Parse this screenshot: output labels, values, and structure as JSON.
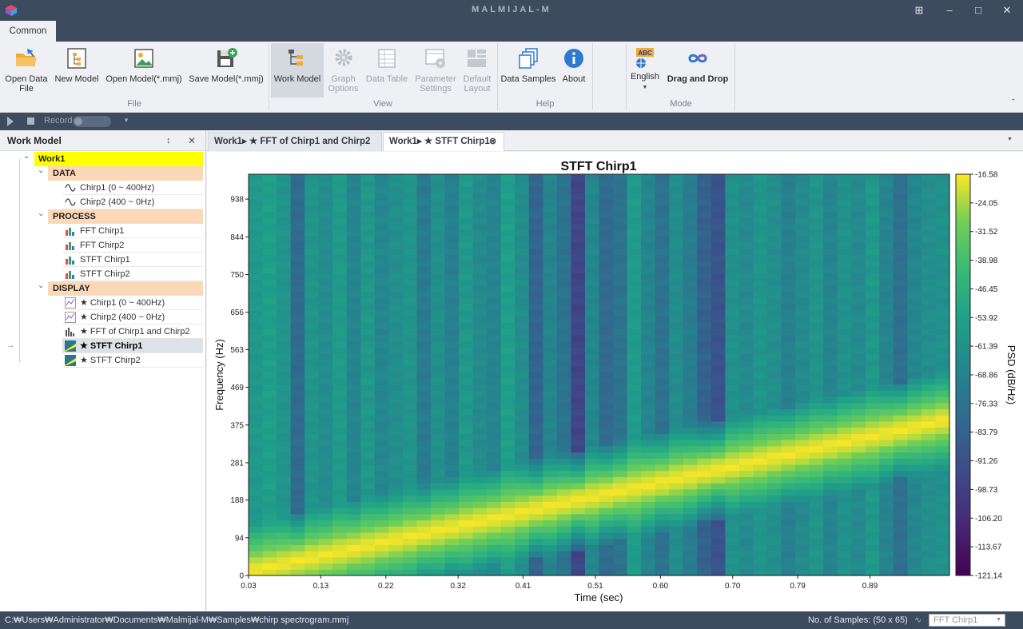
{
  "app": {
    "title": "MALMIJAL-M"
  },
  "tabs": {
    "common": "Common"
  },
  "ribbon": {
    "file": {
      "label": "File",
      "open_data_file": "Open Data File",
      "new_model": "New Model",
      "open_model": "Open Model(*.mmj)",
      "save_model": "Save Model(*.mmj)"
    },
    "view": {
      "label": "View",
      "work_model": "Work Model",
      "graph_options": "Graph Options",
      "data_table": "Data Table",
      "parameter_settings": "Parameter Settings",
      "default_layout": "Default Layout"
    },
    "help": {
      "label": "Help",
      "data_samples": "Data Samples",
      "about": "About"
    },
    "mode": {
      "label": "Mode",
      "english": "English",
      "abc": "ABC",
      "drag_and_drop": "Drag and Drop"
    }
  },
  "recordbar": {
    "record": "Record"
  },
  "work_model": {
    "title": "Work Model",
    "root": "Work1",
    "categories": [
      {
        "label": "DATA",
        "items": [
          "Chirp1 (0 ~ 400Hz)",
          "Chirp2 (400 ~ 0Hz)"
        ]
      },
      {
        "label": "PROCESS",
        "items": [
          "FFT Chirp1",
          "FFT Chirp2",
          "STFT Chirp1",
          "STFT Chirp2"
        ]
      },
      {
        "label": "DISPLAY",
        "items": [
          "★ Chirp1 (0 ~ 400Hz)",
          "★ Chirp2 (400 ~ 0Hz)",
          "★ FFT of Chirp1 and Chirp2",
          "★ STFT Chirp1",
          "★ STFT Chirp2"
        ]
      }
    ],
    "selected": "★ STFT Chirp1"
  },
  "doc_tabs": [
    {
      "label": "Work1▸ ★ FFT of Chirp1 and Chirp2",
      "active": false
    },
    {
      "label": "Work1▸ ★ STFT Chirp1",
      "active": true
    }
  ],
  "status": {
    "path": "C:₩Users₩Administrator₩Documents₩Malmijal-M₩Samples₩chirp spectrogram.mmj",
    "samples": "No. of Samples: (50 x 65)",
    "selector": "FFT Chirp1"
  },
  "colors": {
    "titlebar": "#3d4b5e",
    "category_bg": "#fbd9b8",
    "root_bg": "#ffff00"
  },
  "chart_data": {
    "type": "heatmap",
    "title": "STFT Chirp1",
    "xlabel": "Time (sec)",
    "ylabel": "Frequency (Hz)",
    "colorbar_label": "PSD (dB/Hz)",
    "x_ticks": [
      "0.03",
      "0.13",
      "0.22",
      "0.32",
      "0.41",
      "0.51",
      "0.60",
      "0.70",
      "0.79",
      "0.89"
    ],
    "y_ticks": [
      "0",
      "94",
      "188",
      "281",
      "375",
      "469",
      "563",
      "656",
      "750",
      "844",
      "938"
    ],
    "colorbar_ticks": [
      "-16.58",
      "-24.05",
      "-31.52",
      "-38.98",
      "-46.45",
      "-53.92",
      "-61.39",
      "-68.86",
      "-76.33",
      "-83.79",
      "-91.26",
      "-98.73",
      "-106.20",
      "-113.67",
      "-121.14"
    ],
    "colorbar_range": [
      -121.14,
      -16.58
    ],
    "x_range": [
      0.03,
      1.0
    ],
    "y_range": [
      0,
      1000
    ],
    "n_time_bins": 50,
    "n_freq_bins": 65,
    "ridge": {
      "t_start": 0.03,
      "f_start": 10,
      "t_end": 1.0,
      "f_end": 390
    },
    "background_level_db": -60,
    "column_offsets_db": [
      3,
      6,
      0,
      -25,
      0,
      -5,
      4,
      -10,
      2,
      -8,
      -4,
      0,
      -15,
      -3,
      -12,
      2,
      -6,
      -10,
      6,
      -5,
      -28,
      -10,
      -20,
      -45,
      -8,
      -25,
      -20,
      4,
      -10,
      -20,
      -5,
      -14,
      -30,
      -38,
      -2,
      -6,
      0,
      -4,
      -12,
      -6,
      0,
      -10,
      -2,
      -6,
      2,
      -10,
      -22,
      -8,
      -4,
      -2
    ]
  }
}
